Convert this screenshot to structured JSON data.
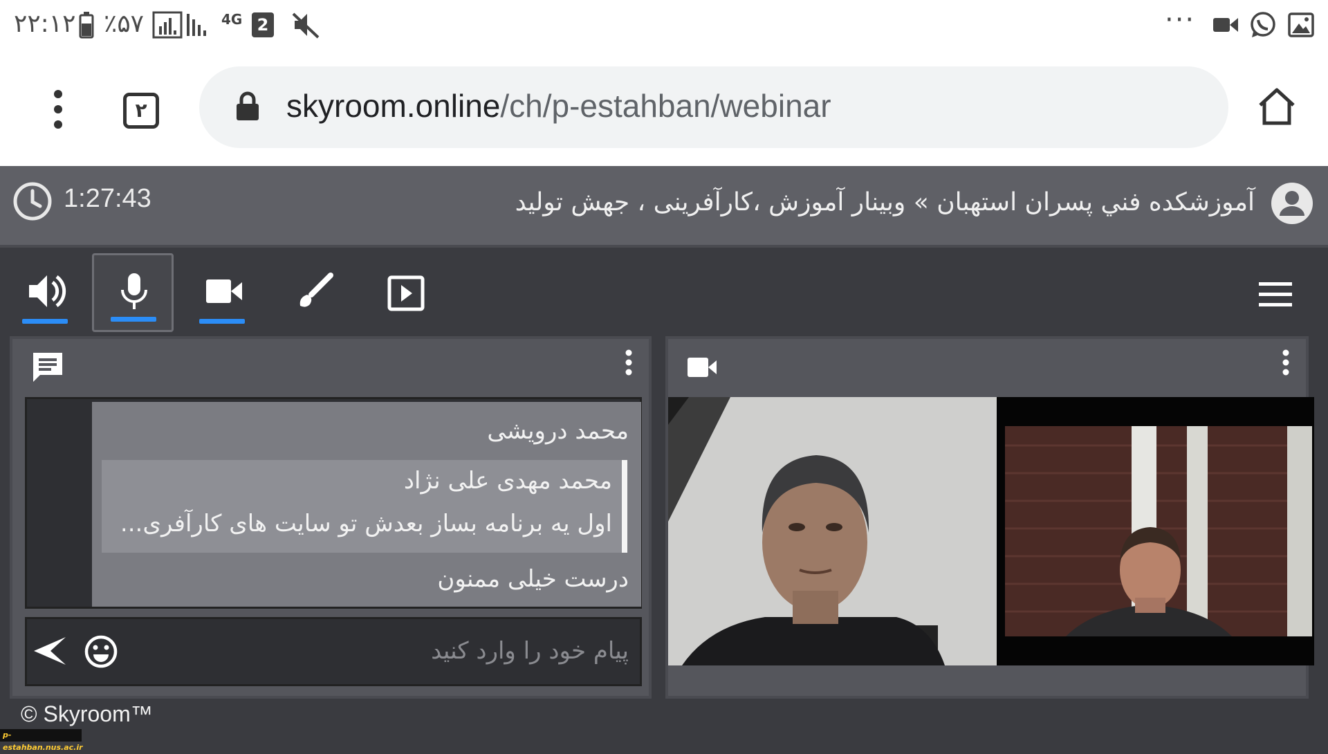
{
  "status_bar": {
    "time": "۲۲:۱۲",
    "battery": "٪۵۷",
    "network": "4G",
    "sim_badge": "2",
    "icons": [
      "battery-icon",
      "signal-icon",
      "signal-icon",
      "network-4g-icon",
      "sim-icon",
      "mute-icon",
      "more-icon",
      "video-icon",
      "whatsapp-icon",
      "gallery-icon"
    ]
  },
  "browser": {
    "tab_count": "۲",
    "url_host": "skyroom.online",
    "url_path": "/ch/p-estahban/webinar"
  },
  "header": {
    "timer": "1:27:43",
    "title": "آموزشکده فني پسران استهبان » وبينار آموزش ،کارآفرینی ، جهش تولید"
  },
  "toolbar": {
    "tools": [
      "speaker",
      "microphone",
      "camera",
      "whiteboard",
      "media"
    ],
    "accent_color": "#2b8df7"
  },
  "chat": {
    "sender": "محمد درویشی",
    "quoted_sender": "محمد مهدی علی نژاد",
    "quoted_text": "اول یه برنامه بساز بعدش تو سایت های کارآفری...",
    "message": "درست خیلی ممنون",
    "input_placeholder": "پیام خود را وارد کنید"
  },
  "footer": {
    "copyright": "© Skyroom™",
    "watermark": "p-estahban.nus.ac.ir"
  }
}
